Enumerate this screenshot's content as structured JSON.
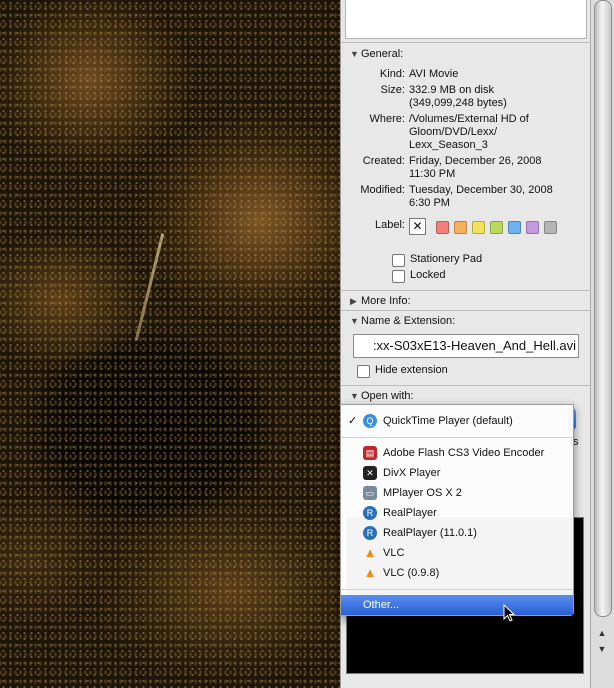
{
  "general": {
    "header": "General:",
    "kind_label": "Kind:",
    "kind": "AVI Movie",
    "size_label": "Size:",
    "size_line1": "332.9 MB on disk",
    "size_line2": "(349,099,248 bytes)",
    "where_label": "Where:",
    "where_line1": "/Volumes/External HD of",
    "where_line2": "Gloom/DVD/Lexx/",
    "where_line3": "Lexx_Season_3",
    "created_label": "Created:",
    "created_line1": "Friday, December 26, 2008",
    "created_line2": "11:30 PM",
    "modified_label": "Modified:",
    "modified_line1": "Tuesday, December 30, 2008",
    "modified_line2": "6:30 PM",
    "label_label": "Label:",
    "label_none": "✕",
    "label_colors": [
      "#f0827a",
      "#f4b15c",
      "#f2e25e",
      "#b8d95c",
      "#6fb0f0",
      "#c49ae0",
      "#b5b5b5"
    ],
    "stationery": "Stationery Pad",
    "locked": "Locked"
  },
  "more_info": {
    "header": "More Info:"
  },
  "name_ext": {
    "header": "Name & Extension:",
    "filename": ":xx-S03xE13-Heaven_And_Hell.avi",
    "hide_ext": "Hide extension"
  },
  "open_with": {
    "header": "Open with:",
    "partial_text": "ts"
  },
  "menu": {
    "check": "✓",
    "items": [
      {
        "label": "QuickTime Player (default)",
        "icon": "quicktime-icon",
        "color": "#3a8fe0"
      },
      {
        "label": "Adobe Flash CS3 Video Encoder",
        "icon": "flash-encoder-icon",
        "color": "#c0262d"
      },
      {
        "label": "DivX Player",
        "icon": "divx-icon",
        "color": "#222222"
      },
      {
        "label": "MPlayer OS X 2",
        "icon": "mplayer-icon",
        "color": "#7a8a9a"
      },
      {
        "label": "RealPlayer",
        "icon": "realplayer-icon",
        "color": "#2a6fb8"
      },
      {
        "label": "RealPlayer (11.0.1)",
        "icon": "realplayer-icon",
        "color": "#2a6fb8"
      },
      {
        "label": "VLC",
        "icon": "vlc-icon",
        "color": "#f08a1c"
      },
      {
        "label": "VLC (0.9.8)",
        "icon": "vlc-icon",
        "color": "#f08a1c"
      },
      {
        "label": "Other..."
      }
    ]
  },
  "scrollbar": {
    "up": "▲",
    "down": "▼"
  }
}
